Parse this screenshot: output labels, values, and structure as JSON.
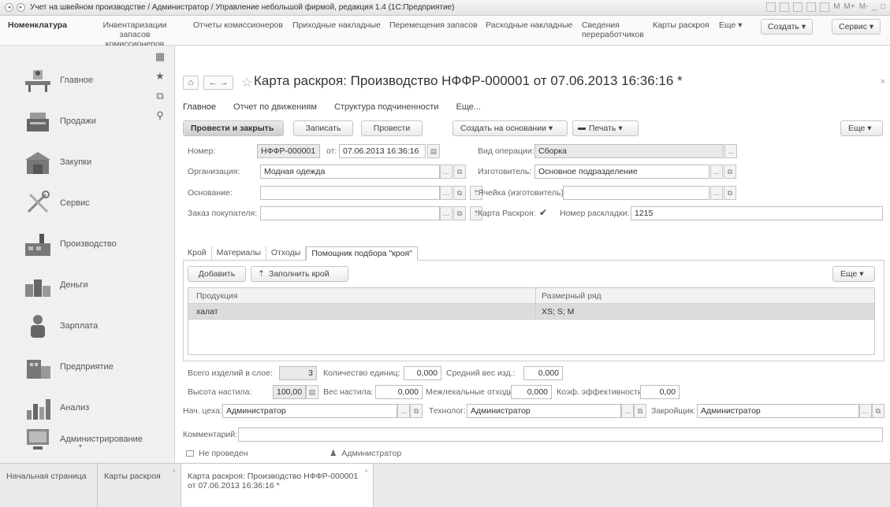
{
  "window": {
    "title": "Учет на швейном производстве / Администратор / Управление небольшой фирмой, редакция 1.4 (1С:Предприятие)",
    "right_controls": [
      "M",
      "M+",
      "M-"
    ]
  },
  "topmenu": {
    "items": [
      {
        "label": "Номенклатура",
        "bold": true
      },
      {
        "label": "Инвентаризации запасов комиссионеров"
      },
      {
        "label": "Отчеты комиссионеров"
      },
      {
        "label": "Приходные накладные"
      },
      {
        "label": "Перемещения запасов"
      },
      {
        "label": "Расходные накладные"
      },
      {
        "label": "Сведения переработчиков"
      },
      {
        "label": "Карты раскроя"
      },
      {
        "label": "Еще ▾"
      }
    ],
    "create_label": "Создать ▾",
    "service_label": "Сервис ▾"
  },
  "sidebar": {
    "items": [
      {
        "label": "Главное",
        "icon": "desk-icon"
      },
      {
        "label": "Продажи",
        "icon": "cash-register-icon"
      },
      {
        "label": "Закупки",
        "icon": "warehouse-icon"
      },
      {
        "label": "Сервис",
        "icon": "tools-icon"
      },
      {
        "label": "Производство",
        "icon": "factory-icon"
      },
      {
        "label": "Деньги",
        "icon": "money-icon"
      },
      {
        "label": "Зарплата",
        "icon": "person-icon"
      },
      {
        "label": "Предприятие",
        "icon": "building-icon"
      },
      {
        "label": "Анализ",
        "icon": "chart-icon"
      },
      {
        "label": "Администрирование",
        "icon": "admin-icon"
      }
    ]
  },
  "document": {
    "title": "Карта раскроя: Производство НФФР-000001 от 07.06.2013 16:36:16 *",
    "subnav": [
      "Главное",
      "Отчет по движениям",
      "Структура подчиненности",
      "Еще..."
    ],
    "toolbar": {
      "post_close": "Провести и закрыть",
      "save": "Записать",
      "post": "Провести",
      "create_based": "Создать на основании  ▾",
      "print": "Печать  ▾",
      "more": "Еще  ▾"
    },
    "fields": {
      "number_label": "Номер:",
      "number_value": "НФФР-000001",
      "date_label": "от:",
      "date_value": "07.06.2013 16:36:16",
      "operation_label": "Вид операции:",
      "operation_value": "Сборка",
      "org_label": "Организация:",
      "org_value": "Модная одежда",
      "maker_label": "Изготовитель:",
      "maker_value": "Основное подразделение",
      "basis_label": "Основание:",
      "basis_value": "",
      "cell_label": "Ячейка (изготовитель):",
      "cell_value": "",
      "order_label": "Заказ покупателя:",
      "order_value": "",
      "card_label": "Карта Раскроя:",
      "layout_label": "Номер раскладки:",
      "layout_value": "1215"
    },
    "tabs": [
      "Крой",
      "Материалы",
      "Отходы",
      "Помощник подбора \"кроя\""
    ],
    "tab_toolbar": {
      "add": "Добавить",
      "fill": "Заполнить крой",
      "more": "Еще  ▾"
    },
    "grid": {
      "columns": [
        "Продукция",
        "Размерный ряд"
      ],
      "rows": [
        {
          "product": "халат",
          "sizes": "XS; S; M"
        }
      ]
    },
    "summary": {
      "total_label": "Всего изделий в слое:",
      "total_value": "3",
      "units_label": "Количество единиц:",
      "units_value": "0,000",
      "avg_label": "Средний вес изд.:",
      "avg_value": "0,000",
      "height_label": "Высота настила:",
      "height_value": "100,00",
      "weight_label": "Вес настила:",
      "weight_value": "0,000",
      "waste_label": "Межлекальные отходы:",
      "waste_value": "0,000",
      "eff_label": "Коэф. эффективности:",
      "eff_value": "0,00"
    },
    "staff": {
      "head_label": "Нач. цеха:",
      "head_value": "Администратор",
      "tech_label": "Технолог:",
      "tech_value": "Администратор",
      "cutter_label": "Закройщик:",
      "cutter_value": "Администратор"
    },
    "comment_label": "Комментарий:",
    "comment_value": "",
    "status": "Не проведен",
    "author": "Администратор"
  },
  "bottom_tabs": [
    {
      "label": "Начальная страница"
    },
    {
      "label": "Карты раскроя"
    },
    {
      "label": "Карта раскроя: Производство НФФР-000001",
      "label2": "от 07.06.2013 16:36:16 *"
    }
  ]
}
